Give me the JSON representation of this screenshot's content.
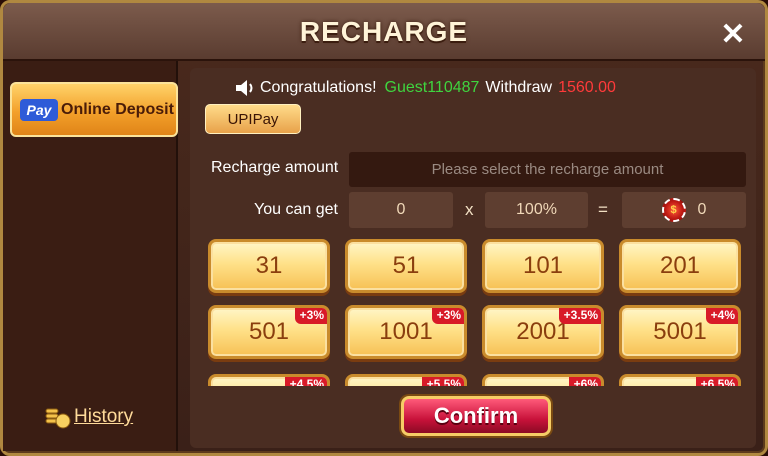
{
  "header": {
    "title": "RECHARGE"
  },
  "sidebar": {
    "pay_badge": "Pay",
    "online_deposit": "Online Deposit",
    "history": "History"
  },
  "notice": {
    "text": "Congratulations!",
    "user": "Guest110487",
    "action": "Withdraw",
    "amount": "1560.00"
  },
  "tabs": [
    {
      "label": "UPIPay"
    }
  ],
  "recharge": {
    "amount_label": "Recharge amount",
    "amount_placeholder": "Please select the recharge amount",
    "get_label": "You can get",
    "base": "0",
    "times": "x",
    "rate": "100%",
    "equals": "=",
    "result": "0"
  },
  "amounts": [
    {
      "value": "31",
      "bonus": ""
    },
    {
      "value": "51",
      "bonus": ""
    },
    {
      "value": "101",
      "bonus": ""
    },
    {
      "value": "201",
      "bonus": ""
    },
    {
      "value": "501",
      "bonus": "+3%"
    },
    {
      "value": "1001",
      "bonus": "+3%"
    },
    {
      "value": "2001",
      "bonus": "+3.5%"
    },
    {
      "value": "5001",
      "bonus": "+4%"
    },
    {
      "value": "",
      "bonus": "+4.5%"
    },
    {
      "value": "",
      "bonus": "+5.5%"
    },
    {
      "value": "",
      "bonus": "+6%"
    },
    {
      "value": "",
      "bonus": "+6.5%"
    }
  ],
  "confirm_label": "Confirm",
  "colors": {
    "frame_gold": "#b08840",
    "panel_brown": "#4a2d22",
    "accent_green": "#3fd43f",
    "accent_red": "#ff3a3a",
    "confirm_red": "#c8123a"
  }
}
